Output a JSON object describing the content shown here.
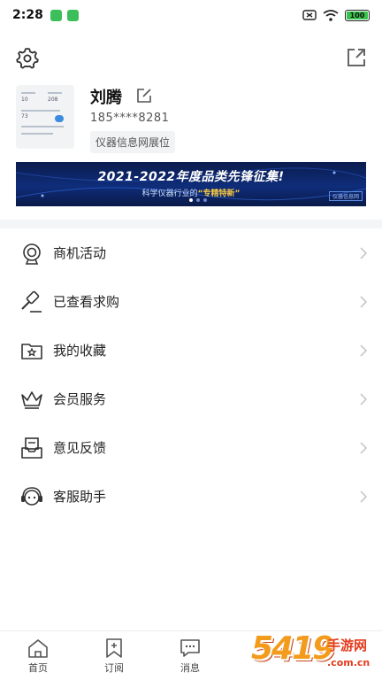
{
  "status_bar": {
    "time": "2:28",
    "battery": "100",
    "battery_level": 1.0
  },
  "profile": {
    "name": "刘腾",
    "phone": "185****8281",
    "tag": "仪器信息网展位",
    "avatar_numbers": [
      "10",
      "208",
      "73"
    ]
  },
  "banner": {
    "title": "2021-2022年度品类先锋征集!",
    "subtitle_prefix": "科学仪器行业的",
    "subtitle_highlight": "“专精特新”",
    "corner_tag": "仪器信息网"
  },
  "menu": {
    "items": [
      {
        "label": "商机活动",
        "icon": "business-opportunity-icon"
      },
      {
        "label": "已查看求购",
        "icon": "gavel-icon"
      },
      {
        "label": "我的收藏",
        "icon": "folder-star-icon"
      },
      {
        "label": "会员服务",
        "icon": "crown-icon"
      },
      {
        "label": "意见反馈",
        "icon": "feedback-tray-icon"
      },
      {
        "label": "客服助手",
        "icon": "customer-service-icon"
      }
    ]
  },
  "tabbar": {
    "items": [
      {
        "label": "首页",
        "icon": "home-icon"
      },
      {
        "label": "订阅",
        "icon": "bookmark-icon"
      },
      {
        "label": "消息",
        "icon": "message-icon"
      }
    ]
  },
  "watermark": {
    "number": "5419",
    "text": "手游网",
    "domain": ".com.cn"
  },
  "colors": {
    "accent": "#3cbf5a",
    "banner_bg": "#0f2d7a",
    "watermark": "#f39b1c"
  }
}
